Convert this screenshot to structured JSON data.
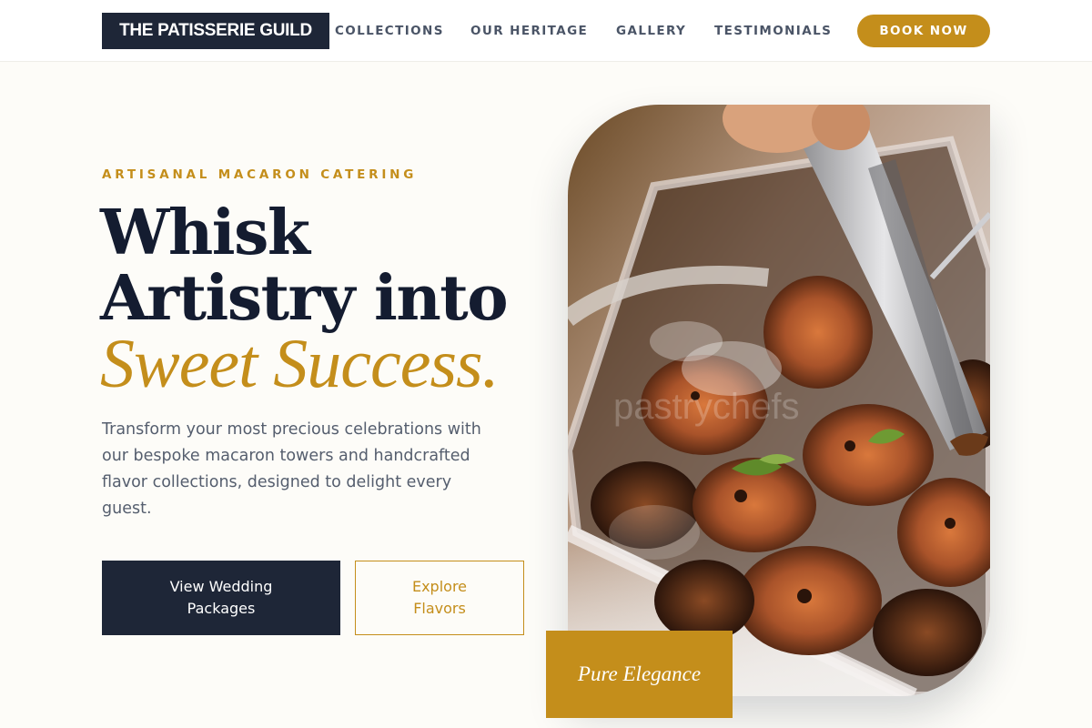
{
  "header": {
    "logo": "THE PATISSERIE GUILD",
    "nav": [
      "COLLECTIONS",
      "OUR HERITAGE",
      "GALLERY",
      "TESTIMONIALS"
    ],
    "cta": "BOOK NOW"
  },
  "hero": {
    "eyebrow": "ARTISANAL MACARON CATERING",
    "headline_line1": "Whisk",
    "headline_line2": "Artistry into",
    "headline_accent": "Sweet Success.",
    "description": "Transform your most precious celebrations with our bespoke macaron towers and handcrafted flavor collections, designed to delight every guest.",
    "primary_button": "View Wedding Packages",
    "secondary_button": "Explore Flavors",
    "badge": "Pure Elegance",
    "image_watermark": "pastrychefs"
  },
  "colors": {
    "navy": "#1e2637",
    "gold": "#c48e1b",
    "cream": "#fdfcf8"
  }
}
